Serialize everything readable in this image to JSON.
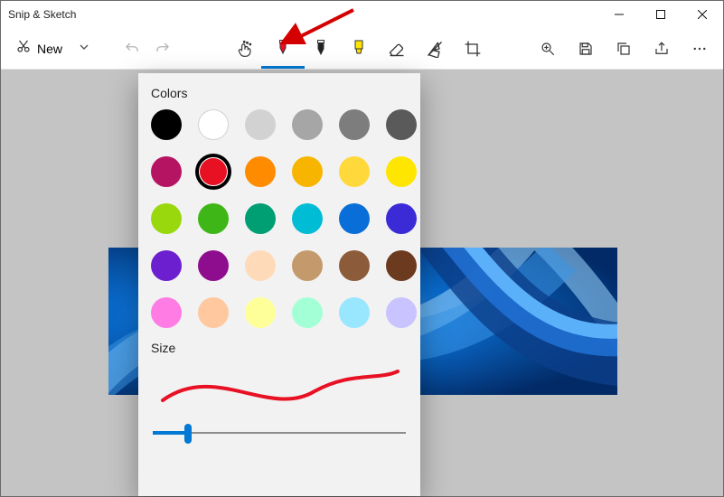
{
  "titlebar": {
    "title": "Snip & Sketch"
  },
  "toolbar": {
    "new_label": "New"
  },
  "popup": {
    "colors_heading": "Colors",
    "size_heading": "Size",
    "swatches": [
      {
        "hex": "#000000",
        "name": "black"
      },
      {
        "hex": "#ffffff",
        "name": "white",
        "white": true
      },
      {
        "hex": "#d2d2d2",
        "name": "light-gray"
      },
      {
        "hex": "#a6a6a6",
        "name": "gray"
      },
      {
        "hex": "#7d7d7d",
        "name": "dark-gray"
      },
      {
        "hex": "#5a5a5a",
        "name": "darker-gray"
      },
      {
        "hex": "#b51462",
        "name": "magenta"
      },
      {
        "hex": "#e81123",
        "name": "red",
        "selected": true
      },
      {
        "hex": "#ff8c00",
        "name": "orange"
      },
      {
        "hex": "#f7b500",
        "name": "gold"
      },
      {
        "hex": "#ffd93b",
        "name": "amber"
      },
      {
        "hex": "#ffe600",
        "name": "yellow"
      },
      {
        "hex": "#98d80c",
        "name": "yellow-green"
      },
      {
        "hex": "#3fb618",
        "name": "green"
      },
      {
        "hex": "#009e73",
        "name": "teal-green"
      },
      {
        "hex": "#00bcd4",
        "name": "cyan"
      },
      {
        "hex": "#0a6ed8",
        "name": "blue"
      },
      {
        "hex": "#3a2bd7",
        "name": "indigo"
      },
      {
        "hex": "#6b1fcf",
        "name": "purple"
      },
      {
        "hex": "#8e0d8e",
        "name": "violet"
      },
      {
        "hex": "#ffdab9",
        "name": "peach"
      },
      {
        "hex": "#c49a6c",
        "name": "tan"
      },
      {
        "hex": "#8c5b3a",
        "name": "brown"
      },
      {
        "hex": "#6b3a1f",
        "name": "dark-brown"
      },
      {
        "hex": "#ff7ce5",
        "name": "pink"
      },
      {
        "hex": "#ffc89e",
        "name": "light-orange"
      },
      {
        "hex": "#ffff99",
        "name": "light-yellow"
      },
      {
        "hex": "#a3ffd6",
        "name": "mint"
      },
      {
        "hex": "#99e6ff",
        "name": "light-blue"
      },
      {
        "hex": "#c9c3ff",
        "name": "lavender"
      }
    ],
    "slider": {
      "value": 14,
      "min": 0,
      "max": 100
    },
    "preview_stroke_color": "#e81123"
  },
  "accent": "#0078d4"
}
